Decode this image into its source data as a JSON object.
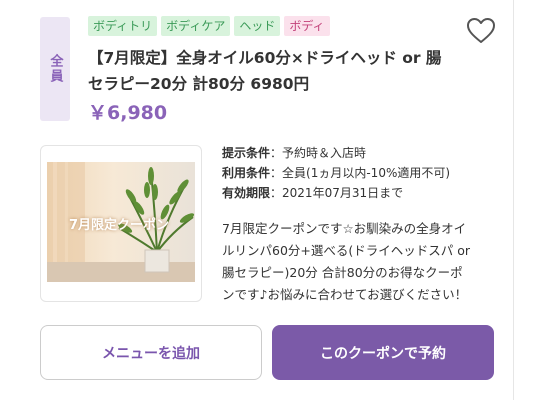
{
  "coupon": {
    "target": "全員",
    "tags": [
      {
        "label": "ボディトリ",
        "color": "#3a9a57"
      },
      {
        "label": "ボディケア",
        "color": "#3a9a57"
      },
      {
        "label": "ヘッド",
        "color": "#3a9a57"
      },
      {
        "label": "ボディ",
        "color": "#c3427a"
      }
    ],
    "title_line1": "【7月限定】全身オイル60分×ドライヘッド or 腸",
    "title_line2": "セラピー20分 計80分 6980円",
    "price": "￥6,980",
    "favorite_icon": "heart-outline-icon",
    "image_caption": "7月限定クーポン",
    "conditions": [
      {
        "label": "提示条件",
        "value": "予約時＆入店時"
      },
      {
        "label": "利用条件",
        "value": "全員(1ヵ月以内-10%適用不可)"
      },
      {
        "label": "有効期限",
        "value": "2021年07月31日まで"
      }
    ],
    "description_lines": [
      "7月限定クーポンです☆お馴染みの全身オイ",
      "ルリンパ60分+選べる(ドライヘッドスパ or",
      "腸セラピー)20分 合計80分のお得なクーポ",
      "ンです♪お悩みに合わせてお選びください！"
    ]
  },
  "actions": {
    "add_menu_label": "メニューを追加",
    "reserve_label": "このクーポンで予約"
  },
  "colors": {
    "accent": "#7b5aa8",
    "price": "#8a63b8",
    "tag_green_bg": "#d8f3dc",
    "tag_pink_bg": "#fbe1ec"
  }
}
